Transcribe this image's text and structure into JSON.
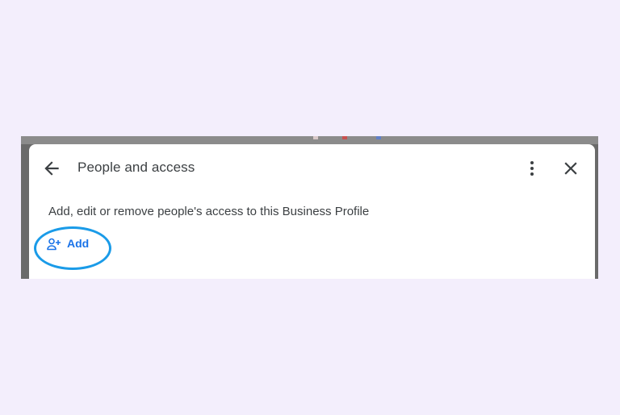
{
  "dialog": {
    "title": "People and access",
    "description": "Add, edit or remove people's access to this Business Profile",
    "back_icon": "arrow-left-icon",
    "more_icon": "more-vert-icon",
    "close_icon": "close-icon"
  },
  "add_button": {
    "label": "Add",
    "icon": "person-add-icon"
  },
  "colors": {
    "page_background": "#f3eefc",
    "accent": "#1a73e8",
    "highlight_ring": "#1a9be8",
    "text": "#3c4043"
  }
}
